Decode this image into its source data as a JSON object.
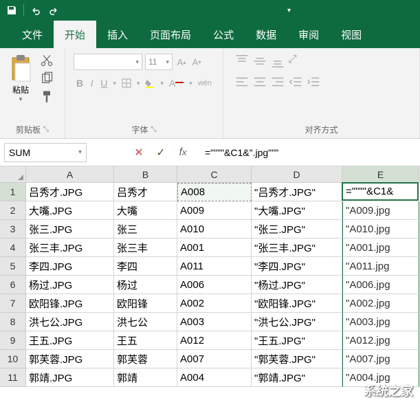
{
  "titlebar": {
    "save_icon": "save-icon",
    "undo_icon": "undo-icon",
    "redo_icon": "redo-icon"
  },
  "tabs": [
    {
      "label": "文件",
      "active": false
    },
    {
      "label": "开始",
      "active": true
    },
    {
      "label": "插入",
      "active": false
    },
    {
      "label": "页面布局",
      "active": false
    },
    {
      "label": "公式",
      "active": false
    },
    {
      "label": "数据",
      "active": false
    },
    {
      "label": "审阅",
      "active": false
    },
    {
      "label": "视图",
      "active": false
    }
  ],
  "ribbon": {
    "clipboard": {
      "paste_label": "粘贴",
      "group_label": "剪贴板"
    },
    "font": {
      "size": "11",
      "group_label": "字体",
      "ruby_label": "wén"
    },
    "align": {
      "group_label": "对齐方式"
    }
  },
  "formula_bar": {
    "name_box": "SUM",
    "formula": "=\"\"\"\"&C1&\".jpg\"\"\""
  },
  "columns": [
    "A",
    "B",
    "C",
    "D",
    "E"
  ],
  "rows": [
    {
      "n": "1",
      "A": "吕秀才.JPG",
      "B": "吕秀才",
      "C": "A008",
      "D": "\"吕秀才.JPG\"",
      "E": "=\"\"\"\"&C1&"
    },
    {
      "n": "2",
      "A": "大嘴.JPG",
      "B": "大嘴",
      "C": "A009",
      "D": "\"大嘴.JPG\"",
      "E": "\"A009.jpg"
    },
    {
      "n": "3",
      "A": "张三.JPG",
      "B": "张三",
      "C": "A010",
      "D": "\"张三.JPG\"",
      "E": "\"A010.jpg"
    },
    {
      "n": "4",
      "A": "张三丰.JPG",
      "B": "张三丰",
      "C": "A001",
      "D": "\"张三丰.JPG\"",
      "E": "\"A001.jpg"
    },
    {
      "n": "5",
      "A": "李四.JPG",
      "B": "李四",
      "C": "A011",
      "D": "\"李四.JPG\"",
      "E": "\"A011.jpg"
    },
    {
      "n": "6",
      "A": "杨过.JPG",
      "B": "杨过",
      "C": "A006",
      "D": "\"杨过.JPG\"",
      "E": "\"A006.jpg"
    },
    {
      "n": "7",
      "A": "欧阳锋.JPG",
      "B": "欧阳锋",
      "C": "A002",
      "D": "\"欧阳锋.JPG\"",
      "E": "\"A002.jpg"
    },
    {
      "n": "8",
      "A": "洪七公.JPG",
      "B": "洪七公",
      "C": "A003",
      "D": "\"洪七公.JPG\"",
      "E": "\"A003.jpg"
    },
    {
      "n": "9",
      "A": "王五.JPG",
      "B": "王五",
      "C": "A012",
      "D": "\"王五.JPG\"",
      "E": "\"A012.jpg"
    },
    {
      "n": "10",
      "A": "郭芙蓉.JPG",
      "B": "郭芙蓉",
      "C": "A007",
      "D": "\"郭芙蓉.JPG\"",
      "E": "\"A007.jpg"
    },
    {
      "n": "11",
      "A": "郭靖.JPG",
      "B": "郭靖",
      "C": "A004",
      "D": "\"郭靖.JPG\"",
      "E": "\"A004.jpg"
    }
  ],
  "active_cell": {
    "row": 0,
    "col": "E"
  },
  "watermark": "系统之家"
}
